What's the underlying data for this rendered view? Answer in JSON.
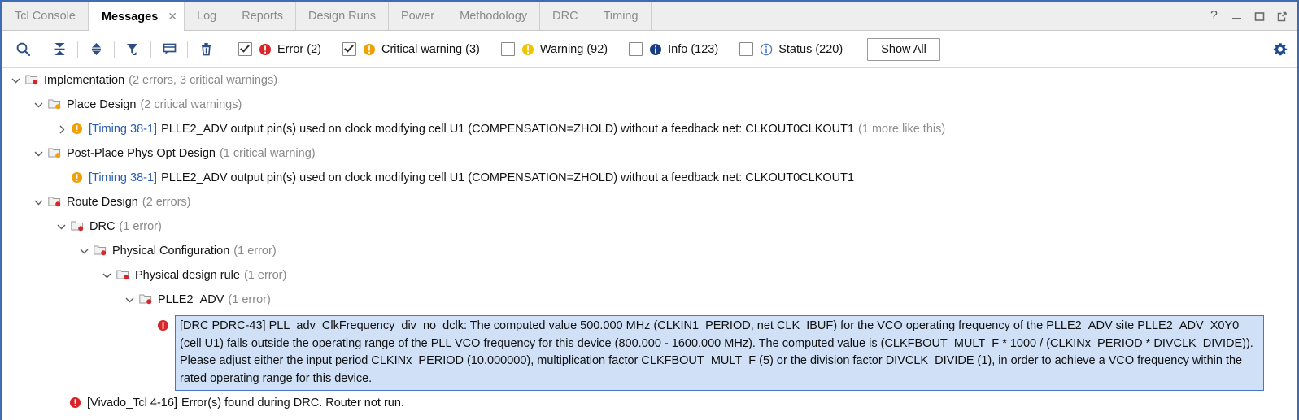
{
  "window": {
    "controls": [
      {
        "name": "help-icon",
        "glyph": "?"
      },
      {
        "name": "minimize-icon",
        "glyph": "—"
      },
      {
        "name": "maximize-icon",
        "glyph": "□"
      },
      {
        "name": "float-icon",
        "glyph": "⇱"
      }
    ]
  },
  "tabs": [
    {
      "label": "Tcl Console",
      "active": false,
      "closable": false
    },
    {
      "label": "Messages",
      "active": true,
      "closable": true,
      "close_glyph": "✕"
    },
    {
      "label": "Log",
      "active": false,
      "closable": false
    },
    {
      "label": "Reports",
      "active": false,
      "closable": false
    },
    {
      "label": "Design Runs",
      "active": false,
      "closable": false
    },
    {
      "label": "Power",
      "active": false,
      "closable": false
    },
    {
      "label": "Methodology",
      "active": false,
      "closable": false
    },
    {
      "label": "DRC",
      "active": false,
      "closable": false
    },
    {
      "label": "Timing",
      "active": false,
      "closable": false
    }
  ],
  "toolbar": {
    "icons": [
      {
        "name": "search-icon"
      },
      {
        "name": "collapse-all-icon"
      },
      {
        "name": "expand-collapse-icon"
      },
      {
        "name": "filter-icon"
      },
      {
        "name": "message-bubble-icon"
      },
      {
        "name": "delete-trash-icon"
      }
    ],
    "filters": [
      {
        "name": "error",
        "label": "Error (2)",
        "checked": true,
        "icon": "error-icon",
        "color": "#d7252a"
      },
      {
        "name": "critical-warning",
        "label": "Critical warning (3)",
        "checked": true,
        "icon": "critical-warning-icon",
        "color": "#f0a000"
      },
      {
        "name": "warning",
        "label": "Warning (92)",
        "checked": false,
        "icon": "warning-icon",
        "color": "#f0c000"
      },
      {
        "name": "info",
        "label": "Info (123)",
        "checked": false,
        "icon": "info-icon",
        "color": "#1a3f8f"
      },
      {
        "name": "status",
        "label": "Status (220)",
        "checked": false,
        "icon": "status-icon",
        "color": "#3a6bb5"
      }
    ],
    "show_all_label": "Show All",
    "settings_icon": "gear-icon"
  },
  "tree": {
    "rows": [
      {
        "type": "folder",
        "indent": 0,
        "twisty": "down",
        "folder_dot": "#d7252a",
        "label": "Implementation",
        "count": "(2 errors, 3 critical warnings)"
      },
      {
        "type": "folder",
        "indent": 1,
        "twisty": "down",
        "folder_dot": "#f0a000",
        "label": "Place Design",
        "count": "(2 critical warnings)"
      },
      {
        "type": "message",
        "indent": 2,
        "twisty": "right",
        "icon": "critical-warning-icon",
        "icon_color": "#f0a000",
        "id": "[Timing 38-1]",
        "text": "PLLE2_ADV output pin(s) used on clock modifying cell U1 (COMPENSATION=ZHOLD) without a feedback net: CLKOUT0CLKOUT1",
        "more": "(1 more like this)"
      },
      {
        "type": "folder",
        "indent": 1,
        "twisty": "down",
        "folder_dot": "#f0a000",
        "label": "Post-Place Phys Opt Design",
        "count": "(1 critical warning)"
      },
      {
        "type": "message",
        "indent": 2,
        "twisty": "none",
        "icon": "critical-warning-icon",
        "icon_color": "#f0a000",
        "id": "[Timing 38-1]",
        "text": "PLLE2_ADV output pin(s) used on clock modifying cell U1 (COMPENSATION=ZHOLD) without a feedback net: CLKOUT0CLKOUT1",
        "more": ""
      },
      {
        "type": "folder",
        "indent": 1,
        "twisty": "down",
        "folder_dot": "#d7252a",
        "label": "Route Design",
        "count": "(2 errors)"
      },
      {
        "type": "folder",
        "indent": 2,
        "twisty": "down",
        "folder_dot": "#d7252a",
        "label": "DRC",
        "count": "(1 error)"
      },
      {
        "type": "folder",
        "indent": 3,
        "twisty": "down",
        "folder_dot": "#d7252a",
        "label": "Physical Configuration",
        "count": "(1 error)"
      },
      {
        "type": "folder",
        "indent": 4,
        "twisty": "down",
        "folder_dot": "#d7252a",
        "label": "Physical design rule",
        "count": "(1 error)"
      },
      {
        "type": "folder",
        "indent": 5,
        "twisty": "down",
        "folder_dot": "#d7252a",
        "label": "PLLE2_ADV",
        "count": "(1 error)"
      },
      {
        "type": "selected-message",
        "indent": 6,
        "twisty": "none",
        "icon": "error-icon",
        "icon_color": "#d7252a",
        "text": "[DRC PDRC-43] PLL_adv_ClkFrequency_div_no_dclk: The computed value 500.000 MHz (CLKIN1_PERIOD, net CLK_IBUF) for the VCO operating frequency of the PLLE2_ADV site PLLE2_ADV_X0Y0 (cell U1) falls outside the operating range of the PLL VCO frequency for this device (800.000 - 1600.000 MHz). The computed value is (CLKFBOUT_MULT_F * 1000 / (CLKINx_PERIOD * DIVCLK_DIVIDE)). Please adjust either the input period CLKINx_PERIOD (10.000000), multiplication factor CLKFBOUT_MULT_F (5) or the division factor DIVCLK_DIVIDE (1), in order to achieve a VCO frequency within the rated operating range for this device."
      },
      {
        "type": "message",
        "indent": 1,
        "twisty": "none",
        "icon": "error-icon",
        "icon_color": "#d7252a",
        "id": "[Vivado_Tcl 4-16]",
        "text": "Error(s) found during DRC. Router not run.",
        "more": ""
      }
    ]
  },
  "colors": {
    "accent_border": "#3f6bb0",
    "selection_bg": "#cfe0f7",
    "selection_border": "#4a76c4",
    "link": "#2a5db0",
    "muted": "#888888"
  }
}
